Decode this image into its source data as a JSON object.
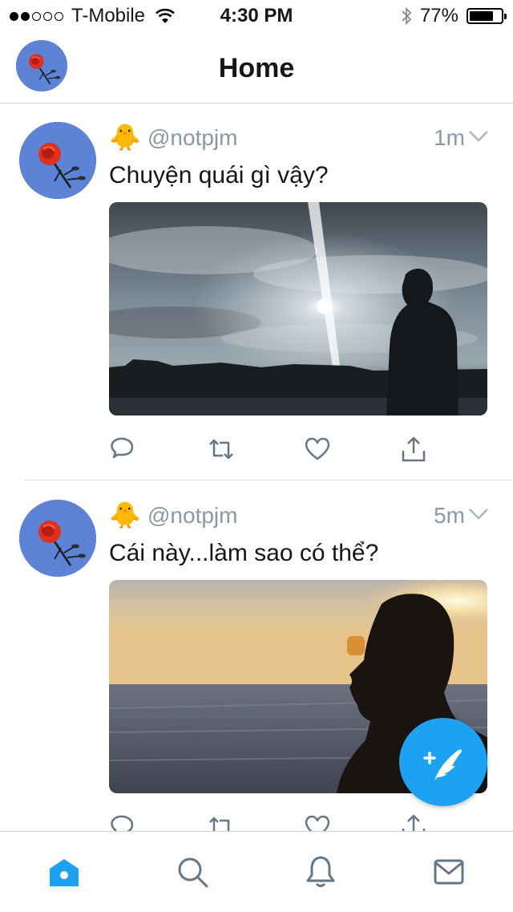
{
  "status_bar": {
    "signal_bars_filled": 2,
    "signal_bars_total": 5,
    "carrier": "T-Mobile",
    "time": "4:30 PM",
    "battery": "77%",
    "battery_level": 0.77
  },
  "nav": {
    "title": "Home",
    "avatar_icon": "rose-avatar-icon"
  },
  "tweets": [
    {
      "emoji": "🐥",
      "handle": "@notpjm",
      "time": "1m",
      "text": "Chuyện quái gì vậy?",
      "media": "photo-silhouette-sunlit-clouds"
    },
    {
      "emoji": "🐥",
      "handle": "@notpjm",
      "time": "5m",
      "text": "Cái này...làm sao có thể?",
      "media": "photo-profile-sunset-sea"
    }
  ],
  "actions": [
    "reply-icon",
    "retweet-icon",
    "like-icon",
    "share-icon"
  ],
  "tabs": [
    "home-icon",
    "search-icon",
    "notifications-icon",
    "messages-icon"
  ],
  "colors": {
    "accent": "#1da1f2",
    "secondary_text": "#8899a6",
    "icon_gray": "#657786",
    "avatar_bg": "#5d83d6"
  }
}
